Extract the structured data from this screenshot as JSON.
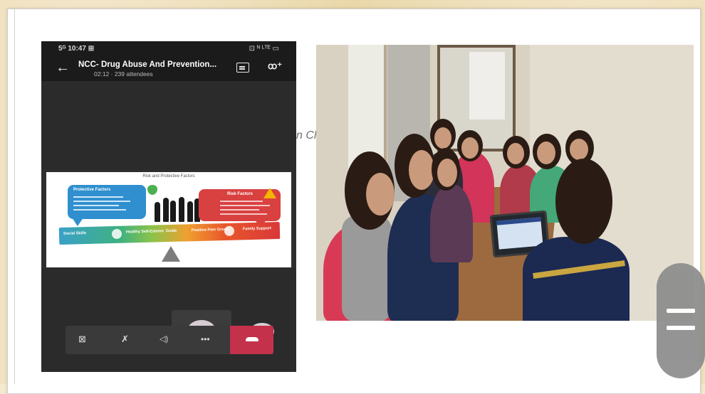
{
  "phone": {
    "status_time": "5ᴳ 10:47 ⊞",
    "status_icons": "⊡ ᴺ ᴸᵀᴱ ▭",
    "meeting_title": "NCC- Drug Abuse And Prevention...",
    "meeting_subtitle": "02:12 · 239 attendees",
    "icons": {
      "back": "back-arrow-icon",
      "chat": "chat-icon",
      "participants": "participants-icon",
      "video": "video-off-icon",
      "mic": "mic-off-icon",
      "speaker": "speaker-icon",
      "more": "more-options-icon",
      "hangup": "hang-up-icon"
    },
    "glyphs": {
      "back": "←",
      "participants": "ꝏ⁺",
      "video": "⊠",
      "mic": "✗",
      "speaker": "◁)",
      "more": "•••"
    },
    "hangup_color": "#c4314b",
    "slide": {
      "title": "Risk and Protective Factors",
      "protective_label": "Protective Factors",
      "risk_label": "Risk Factors",
      "segments": [
        "Social Skills",
        "Healthy Self-Esteem",
        "Goals",
        "Positive Peer Group",
        "Family Support"
      ]
    }
  },
  "overlap_fragment": "n Cl",
  "photo": {
    "alt": "Students in a classroom attending the online session on a tablet"
  },
  "scroll_control": {
    "icon": "scroll-handle-icon",
    "color": "#8c8c8c"
  }
}
